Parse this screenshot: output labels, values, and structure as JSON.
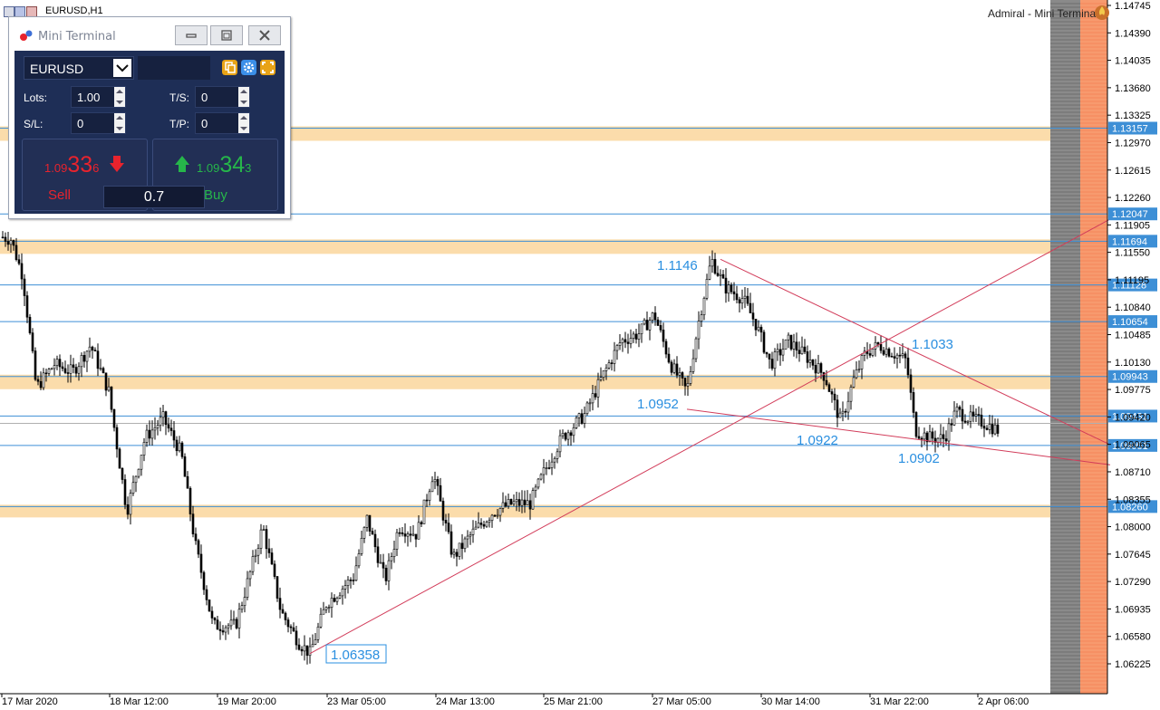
{
  "window": {
    "symbol_tab": "EURUSD,H1",
    "indicator_label": "Admiral - Mini Terminal"
  },
  "price_axis": {
    "ticks": [
      "1.14745",
      "1.14390",
      "1.14035",
      "1.13680",
      "1.13325",
      "1.12970",
      "1.12615",
      "1.12260",
      "1.11905",
      "1.11550",
      "1.11195",
      "1.10840",
      "1.10485",
      "1.10130",
      "1.09775",
      "1.09420",
      "1.09065",
      "1.08710",
      "1.08355",
      "1.08000",
      "1.07645",
      "1.07290",
      "1.06935",
      "1.06580",
      "1.06225"
    ],
    "level_labels": [
      "1.13157",
      "1.12047",
      "1.11694",
      "1.11128",
      "1.10654",
      "1.09943",
      "1.09431",
      "1.09051",
      "1.08260"
    ],
    "current_price": "1.09336"
  },
  "time_axis": {
    "ticks": [
      "17 Mar 2020",
      "18 Mar 12:00",
      "19 Mar 20:00",
      "23 Mar 05:00",
      "24 Mar 13:00",
      "25 Mar 21:00",
      "27 Mar 05:00",
      "30 Mar 14:00",
      "31 Mar 22:00",
      "2 Apr 06:00"
    ]
  },
  "annotations": {
    "low": "1.06358",
    "high": "1.1146",
    "swing1": "1.1033",
    "swing2": "1.0952",
    "swing3": "1.0922",
    "swing4": "1.0902"
  },
  "colors": {
    "level_line": "#3d8fd6",
    "zone_fill": "#fbd8a2",
    "trendline": "#d23c5a",
    "annotation_text": "#2a8fe0",
    "sell_red": "#e8232d",
    "buy_green": "#26b64a",
    "panel_bg": "#1e2e56"
  },
  "mini_terminal": {
    "title": "Mini Terminal",
    "symbol": "EURUSD",
    "lots_label": "Lots:",
    "lots_value": "1.00",
    "ts_label": "T/S:",
    "ts_value": "0",
    "sl_label": "S/L:",
    "sl_value": "0",
    "tp_label": "T/P:",
    "tp_value": "0",
    "sell": {
      "small_left": "1.09",
      "big": "33",
      "small_right": "6",
      "label": "Sell"
    },
    "buy": {
      "small_left": "1.09",
      "big": "34",
      "small_right": "3",
      "label": "Buy"
    },
    "spread": "0.7"
  },
  "icons": [
    "minimize-icon",
    "maximize-icon",
    "close-icon",
    "chevron-down-icon",
    "copy-icon",
    "gear-icon",
    "expand-icon",
    "arrow-down-icon",
    "arrow-up-icon",
    "terminal-logo-icon",
    "indicator-fire-icon"
  ]
}
